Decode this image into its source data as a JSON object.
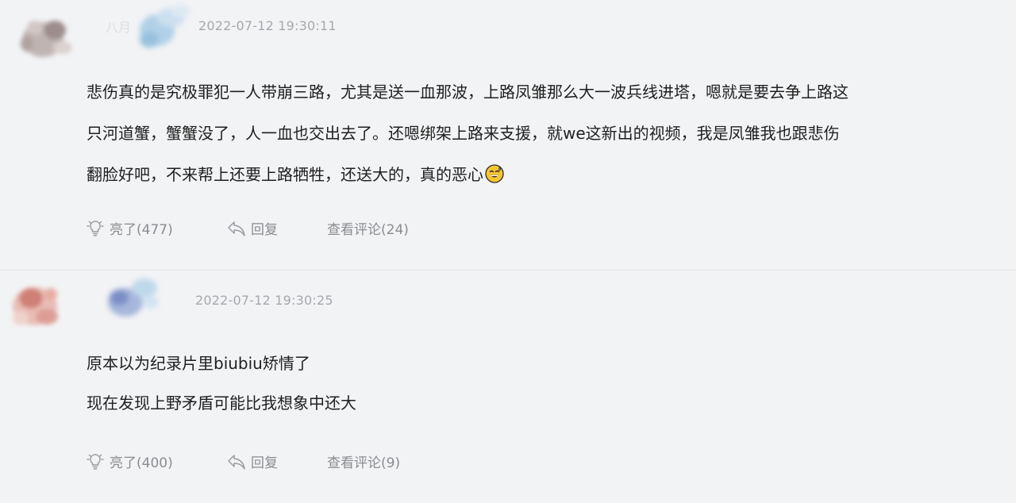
{
  "colors": {
    "background": "#f2f3f5",
    "text": "#1f1f1f",
    "meta_text": "#a6a8ad",
    "action_text": "#8a8c91",
    "divider": "#e3e4e7"
  },
  "comments": [
    {
      "username": "八月",
      "timestamp": "2022-07-12 19:30:11",
      "lines": [
        "悲伤真的是究极罪犯一人带崩三路，尤其是送一血那波，上路凤雏那么大一波兵线进塔，嗯就是要去争上路这",
        "只河道蟹，蟹蟹没了，人一血也交出去了。还嗯绑架上路来支援，就we这新出的视频，我是凤雏我也跟悲伤",
        "翻脸好吧，不来帮上还要上路牺牲，还送大的，真的恶心"
      ],
      "emoji": "sweat-smile-emoji",
      "actions": {
        "like_label": "亮了(477)",
        "reply_label": "回复",
        "view_label": "查看评论(24)"
      }
    },
    {
      "username": "",
      "timestamp": "2022-07-12 19:30:25",
      "lines": [
        "原本以为纪录片里biubiu矫情了",
        "现在发现上野矛盾可能比我想象中还大"
      ],
      "actions": {
        "like_label": "亮了(400)",
        "reply_label": "回复",
        "view_label": "查看评论(9)"
      }
    }
  ]
}
